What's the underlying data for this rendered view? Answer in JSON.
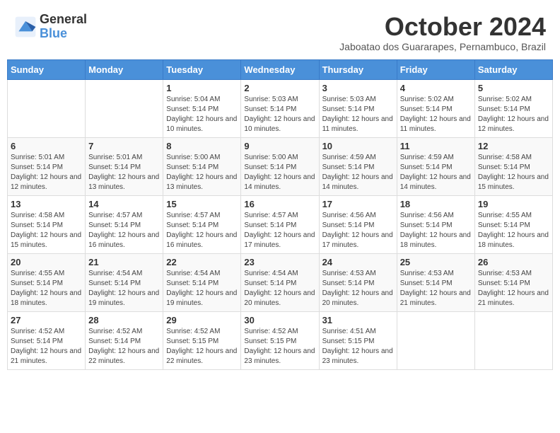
{
  "logo": {
    "general": "General",
    "blue": "Blue"
  },
  "title": "October 2024",
  "subtitle": "Jaboatao dos Guararapes, Pernambuco, Brazil",
  "headers": [
    "Sunday",
    "Monday",
    "Tuesday",
    "Wednesday",
    "Thursday",
    "Friday",
    "Saturday"
  ],
  "weeks": [
    [
      {
        "day": "",
        "info": ""
      },
      {
        "day": "",
        "info": ""
      },
      {
        "day": "1",
        "info": "Sunrise: 5:04 AM\nSunset: 5:14 PM\nDaylight: 12 hours and 10 minutes."
      },
      {
        "day": "2",
        "info": "Sunrise: 5:03 AM\nSunset: 5:14 PM\nDaylight: 12 hours and 10 minutes."
      },
      {
        "day": "3",
        "info": "Sunrise: 5:03 AM\nSunset: 5:14 PM\nDaylight: 12 hours and 11 minutes."
      },
      {
        "day": "4",
        "info": "Sunrise: 5:02 AM\nSunset: 5:14 PM\nDaylight: 12 hours and 11 minutes."
      },
      {
        "day": "5",
        "info": "Sunrise: 5:02 AM\nSunset: 5:14 PM\nDaylight: 12 hours and 12 minutes."
      }
    ],
    [
      {
        "day": "6",
        "info": "Sunrise: 5:01 AM\nSunset: 5:14 PM\nDaylight: 12 hours and 12 minutes."
      },
      {
        "day": "7",
        "info": "Sunrise: 5:01 AM\nSunset: 5:14 PM\nDaylight: 12 hours and 13 minutes."
      },
      {
        "day": "8",
        "info": "Sunrise: 5:00 AM\nSunset: 5:14 PM\nDaylight: 12 hours and 13 minutes."
      },
      {
        "day": "9",
        "info": "Sunrise: 5:00 AM\nSunset: 5:14 PM\nDaylight: 12 hours and 14 minutes."
      },
      {
        "day": "10",
        "info": "Sunrise: 4:59 AM\nSunset: 5:14 PM\nDaylight: 12 hours and 14 minutes."
      },
      {
        "day": "11",
        "info": "Sunrise: 4:59 AM\nSunset: 5:14 PM\nDaylight: 12 hours and 14 minutes."
      },
      {
        "day": "12",
        "info": "Sunrise: 4:58 AM\nSunset: 5:14 PM\nDaylight: 12 hours and 15 minutes."
      }
    ],
    [
      {
        "day": "13",
        "info": "Sunrise: 4:58 AM\nSunset: 5:14 PM\nDaylight: 12 hours and 15 minutes."
      },
      {
        "day": "14",
        "info": "Sunrise: 4:57 AM\nSunset: 5:14 PM\nDaylight: 12 hours and 16 minutes."
      },
      {
        "day": "15",
        "info": "Sunrise: 4:57 AM\nSunset: 5:14 PM\nDaylight: 12 hours and 16 minutes."
      },
      {
        "day": "16",
        "info": "Sunrise: 4:57 AM\nSunset: 5:14 PM\nDaylight: 12 hours and 17 minutes."
      },
      {
        "day": "17",
        "info": "Sunrise: 4:56 AM\nSunset: 5:14 PM\nDaylight: 12 hours and 17 minutes."
      },
      {
        "day": "18",
        "info": "Sunrise: 4:56 AM\nSunset: 5:14 PM\nDaylight: 12 hours and 18 minutes."
      },
      {
        "day": "19",
        "info": "Sunrise: 4:55 AM\nSunset: 5:14 PM\nDaylight: 12 hours and 18 minutes."
      }
    ],
    [
      {
        "day": "20",
        "info": "Sunrise: 4:55 AM\nSunset: 5:14 PM\nDaylight: 12 hours and 18 minutes."
      },
      {
        "day": "21",
        "info": "Sunrise: 4:54 AM\nSunset: 5:14 PM\nDaylight: 12 hours and 19 minutes."
      },
      {
        "day": "22",
        "info": "Sunrise: 4:54 AM\nSunset: 5:14 PM\nDaylight: 12 hours and 19 minutes."
      },
      {
        "day": "23",
        "info": "Sunrise: 4:54 AM\nSunset: 5:14 PM\nDaylight: 12 hours and 20 minutes."
      },
      {
        "day": "24",
        "info": "Sunrise: 4:53 AM\nSunset: 5:14 PM\nDaylight: 12 hours and 20 minutes."
      },
      {
        "day": "25",
        "info": "Sunrise: 4:53 AM\nSunset: 5:14 PM\nDaylight: 12 hours and 21 minutes."
      },
      {
        "day": "26",
        "info": "Sunrise: 4:53 AM\nSunset: 5:14 PM\nDaylight: 12 hours and 21 minutes."
      }
    ],
    [
      {
        "day": "27",
        "info": "Sunrise: 4:52 AM\nSunset: 5:14 PM\nDaylight: 12 hours and 21 minutes."
      },
      {
        "day": "28",
        "info": "Sunrise: 4:52 AM\nSunset: 5:14 PM\nDaylight: 12 hours and 22 minutes."
      },
      {
        "day": "29",
        "info": "Sunrise: 4:52 AM\nSunset: 5:15 PM\nDaylight: 12 hours and 22 minutes."
      },
      {
        "day": "30",
        "info": "Sunrise: 4:52 AM\nSunset: 5:15 PM\nDaylight: 12 hours and 23 minutes."
      },
      {
        "day": "31",
        "info": "Sunrise: 4:51 AM\nSunset: 5:15 PM\nDaylight: 12 hours and 23 minutes."
      },
      {
        "day": "",
        "info": ""
      },
      {
        "day": "",
        "info": ""
      }
    ]
  ]
}
